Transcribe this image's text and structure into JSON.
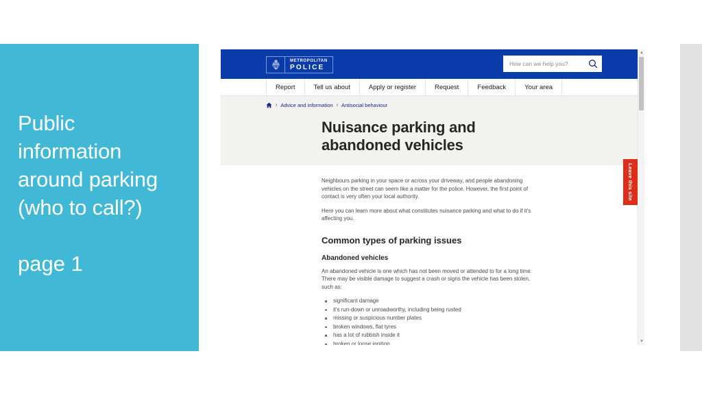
{
  "slide": {
    "title": "Public\ninformation\naround parking\n(who to call?)",
    "subtitle": "page 1",
    "panel_color": "#41b8d5"
  },
  "browser": {
    "masthead": {
      "brand_color": "#0a3bab",
      "logo": {
        "line1": "METROPOLITAN",
        "line2": "POLICE",
        "crest_icon": "police-crest-icon"
      },
      "search": {
        "placeholder": "How can we help you?",
        "value": "",
        "icon": "search-icon"
      }
    },
    "nav": {
      "items": [
        {
          "label": "Report"
        },
        {
          "label": "Tell us about"
        },
        {
          "label": "Apply or register"
        },
        {
          "label": "Request"
        },
        {
          "label": "Feedback"
        },
        {
          "label": "Your area"
        }
      ]
    },
    "breadcrumb": {
      "home_icon": "home-icon",
      "separator": "›",
      "items": [
        {
          "label": "Advice and information"
        },
        {
          "label": "Antisocial behaviour"
        }
      ]
    },
    "page_title": "Nuisance parking and\nabandoned vehicles",
    "article": {
      "intro_p1": "Neighbours parking in your space or across your driveway, and people abandoning vehicles on the street can seem like a matter for the police. However, the first point of contact is very often your local authority.",
      "intro_p2": "Here you can learn more about what constitutes nuisance parking and what to do if it's affecting you.",
      "section_heading": "Common types of parking issues",
      "subsection_heading": "Abandoned vehicles",
      "subsection_p": "An abandoned vehicle is one which has not been moved or attended to for a long time. There may be visible damage to suggest a crash or signs the vehicle has been stolen, such as:",
      "bullets": [
        "significant damage",
        "it's run-down or unroadworthy, including being rusted",
        "missing or suspicious number plates",
        "broken windows, flat tyres",
        "has a lot of rubbish inside it",
        "broken or loose ignition"
      ]
    },
    "leave_site": {
      "label": "Leave this site",
      "color": "#dd2e1c"
    },
    "scrollbar": {
      "up_arrow": "▲",
      "down_arrow": "▼"
    }
  }
}
